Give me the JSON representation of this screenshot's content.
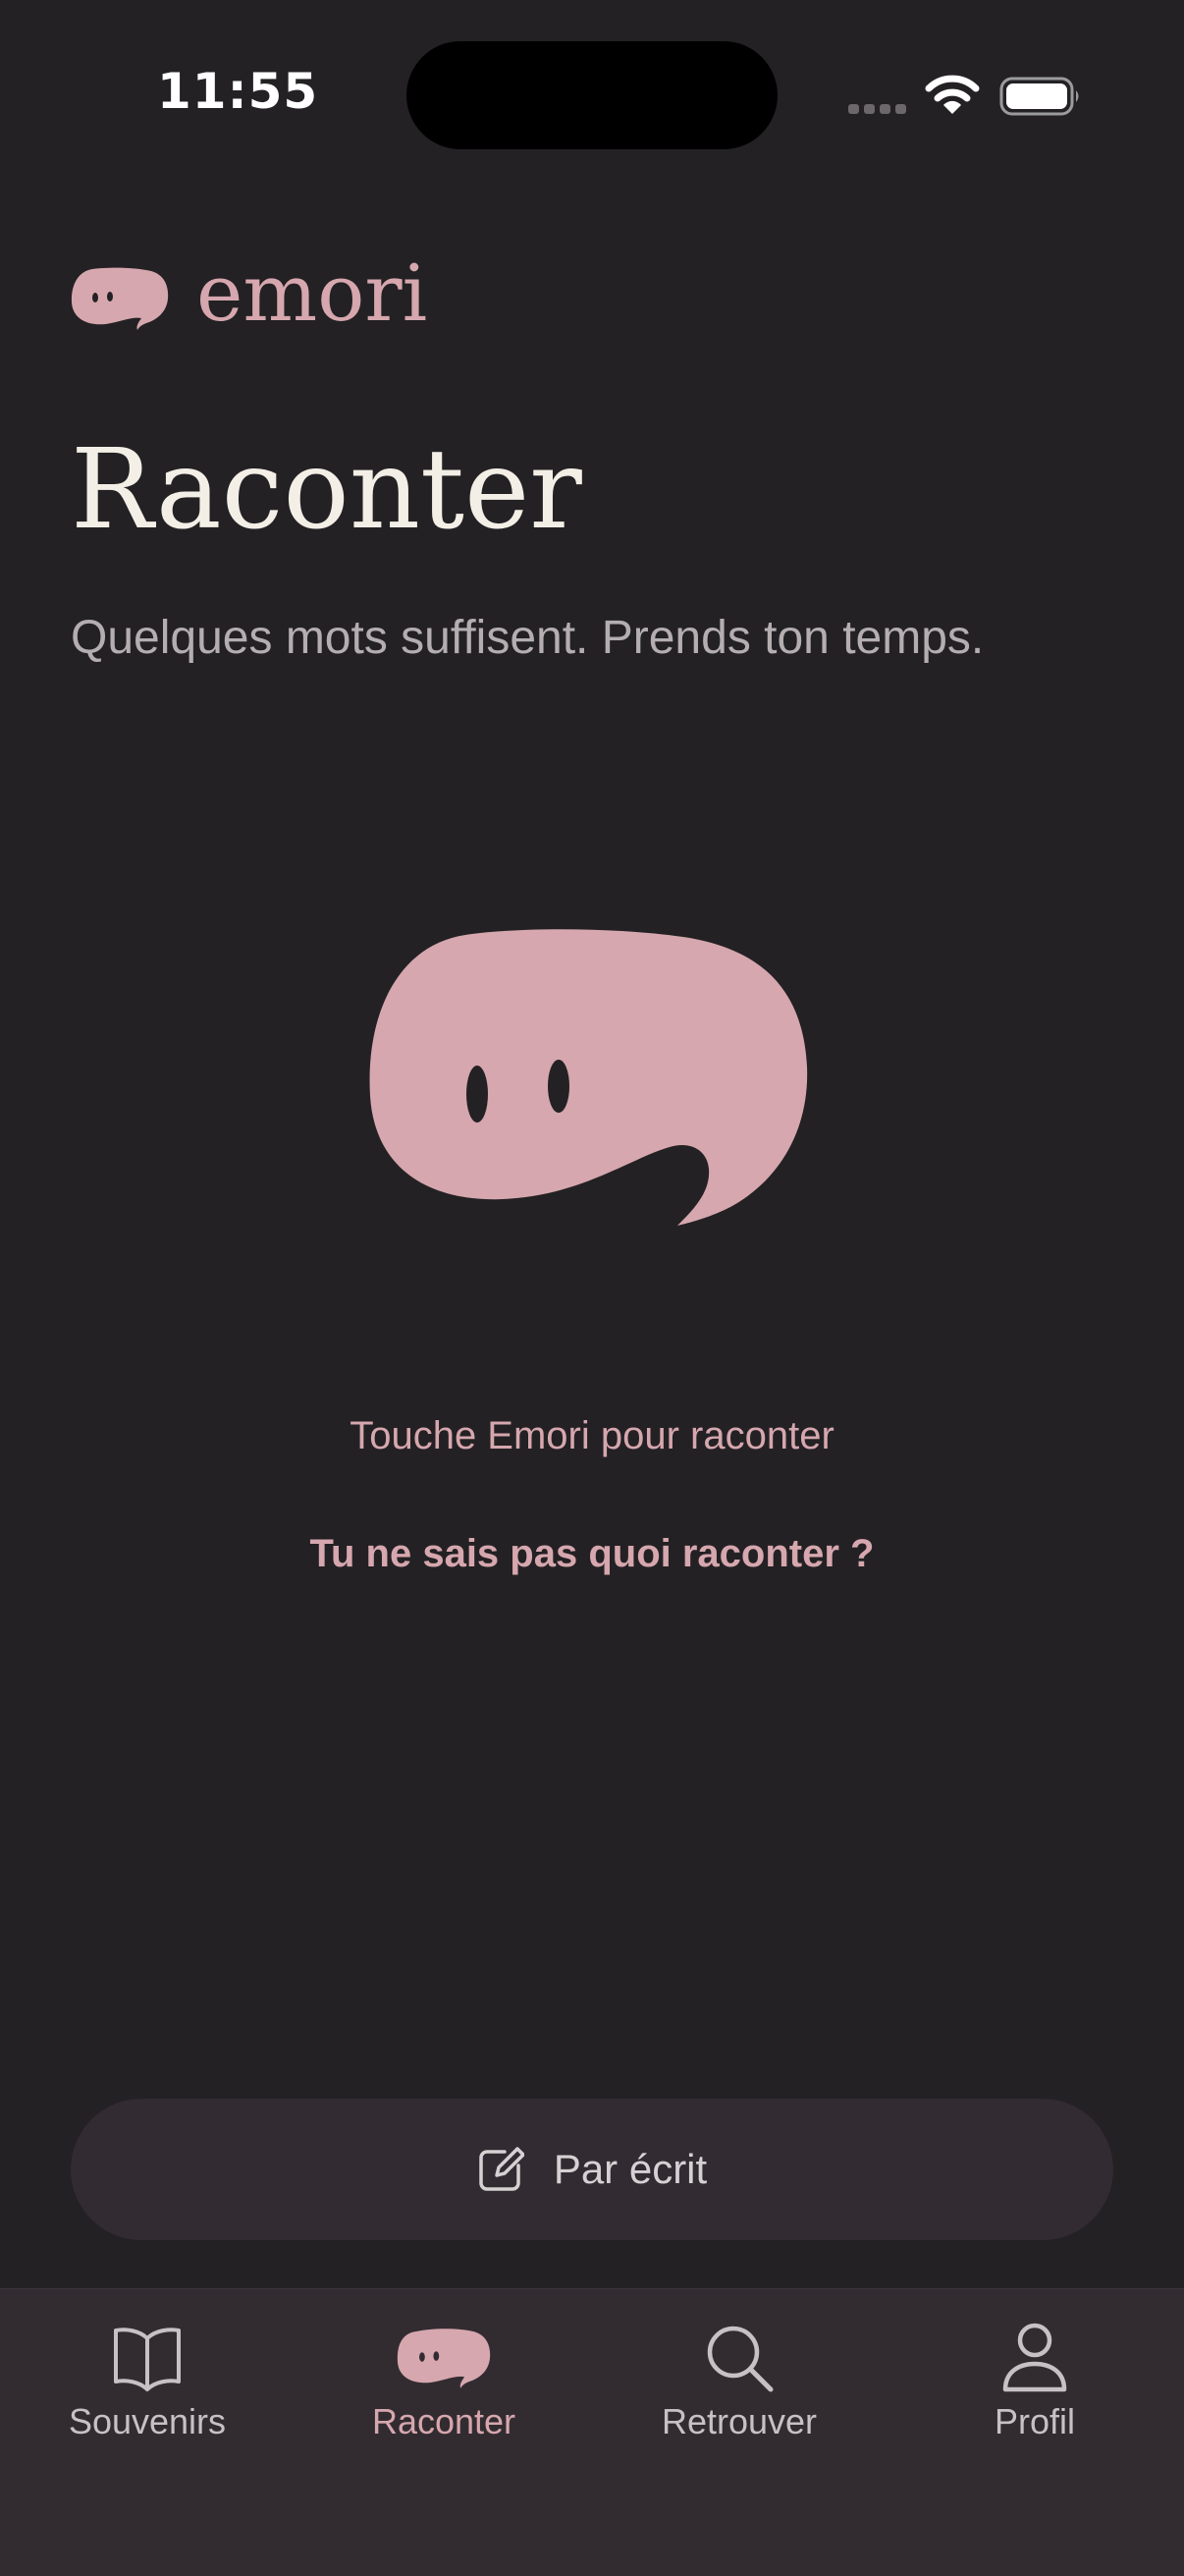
{
  "status_bar": {
    "time": "11:55"
  },
  "brand": {
    "name": "emori",
    "logo_icon": "speech-bubble-mascot-icon"
  },
  "page": {
    "title": "Raconter",
    "subtitle": "Quelques mots suffisent. Prends ton temps."
  },
  "mascot": {
    "icon": "emori-mascot-bubble-icon",
    "hint": "Touche Emori pour raconter"
  },
  "idea_link": {
    "label": "Tu ne sais pas quoi raconter ?"
  },
  "write_button": {
    "label": "Par écrit",
    "icon": "compose-icon"
  },
  "tabs": [
    {
      "label": "Souvenirs",
      "icon": "open-book-icon",
      "active": false
    },
    {
      "label": "Raconter",
      "icon": "speech-bubble-mascot-icon",
      "active": true
    },
    {
      "label": "Retrouver",
      "icon": "search-icon",
      "active": false
    },
    {
      "label": "Profil",
      "icon": "person-icon",
      "active": false
    }
  ],
  "colors": {
    "background": "#232124",
    "accent_pink": "#d6a7ae",
    "title_cream": "#f3efe6",
    "tab_bar": "#322c31"
  }
}
